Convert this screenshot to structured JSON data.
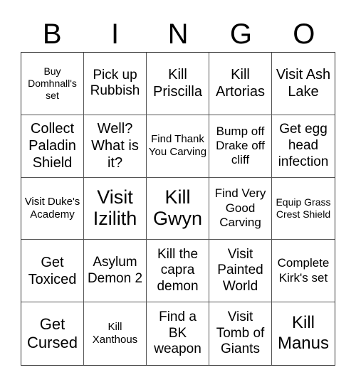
{
  "header": [
    "B",
    "I",
    "N",
    "G",
    "O"
  ],
  "cells": [
    "Buy Domhnall's set",
    "Pick up Rubbish",
    "Kill Priscilla",
    "Kill Artorias",
    "Visit Ash Lake",
    "Collect Paladin Shield",
    "Well? What is it?",
    "Find Thank You Carving",
    "Bump off Drake off cliff",
    "Get egg head infection",
    "Visit Duke's Academy",
    "Visit Izilith",
    "Kill Gwyn",
    "Find Very Good Carving",
    "Equip Grass Crest Shield",
    "Get Toxiced",
    "Asylum Demon 2",
    "Kill the capra demon",
    "Visit Painted World",
    "Complete Kirk's set",
    "Get Cursed",
    "Kill Xanthous",
    "Find a BK weapon",
    "Visit Tomb of Giants",
    "Kill Manus"
  ]
}
